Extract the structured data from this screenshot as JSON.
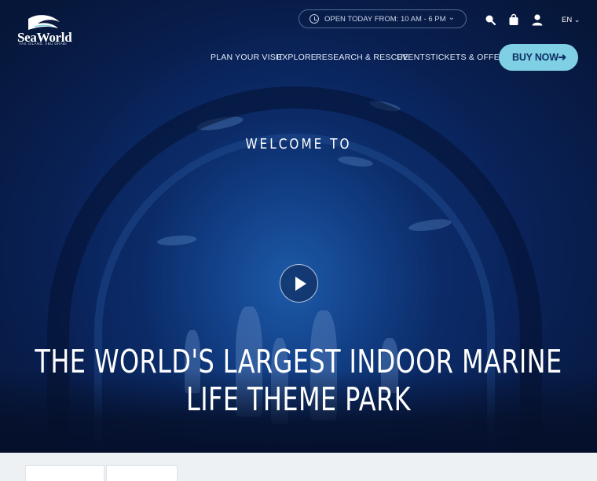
{
  "brand": {
    "name": "SeaWorld",
    "subtitle": "YAS ISLAND, ABU DHABI"
  },
  "topbar": {
    "hours_text": "OPEN TODAY FROM: 10 AM - 6 PM",
    "language": "EN",
    "icons": [
      "clock-icon",
      "chevron-down-icon",
      "search-icon",
      "shopping-bag-icon",
      "user-icon"
    ]
  },
  "nav": {
    "items": [
      "PLAN YOUR VISIT",
      "EXPLORE",
      "RESEARCH & RESCUE",
      "EVENTS",
      "TICKETS & OFFERS"
    ],
    "buy_now": "BUY NOW"
  },
  "hero": {
    "welcome": "WELCOME TO",
    "headline": "THE WORLD'S LARGEST INDOOR MARINE LIFE THEME PARK"
  },
  "colors": {
    "accent": "#7fd0e4",
    "hero_dark": "#061638",
    "text_light": "#ffffff"
  }
}
